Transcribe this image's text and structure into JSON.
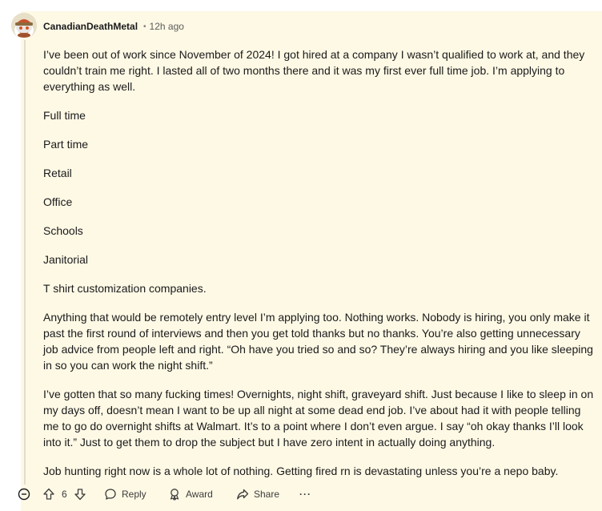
{
  "comment": {
    "username": "CanadianDeathMetal",
    "separator": "•",
    "timestamp": "12h ago",
    "paragraphs": [
      "I’ve been out of work since November of 2024! I got hired at a company I wasn’t qualified to work at, and they couldn’t train me right. I lasted all of two months there and it was my first ever full time job. I’m applying to everything as well.",
      "Full time",
      "Part time",
      "Retail",
      "Office",
      "Schools",
      "Janitorial",
      "T shirt customization companies.",
      "Anything that would be remotely entry level I’m applying too. Nothing works. Nobody is hiring, you only make it past the first round of interviews and then you get told thanks but no thanks. You’re also getting unnecessary job advice from people left and right. “Oh have you tried so and so? They’re always hiring and you like sleeping in so you can work the night shift.”",
      "I’ve gotten that so many fucking times! Overnights, night shift, graveyard shift. Just because I like to sleep in on my days off, doesn’t mean I want to be up all night at some dead end job. I’ve about had it with people telling me to go do overnight shifts at Walmart. It’s to a point where I don’t even argue. I say “oh okay thanks I’ll look into it.” Just to get them to drop the subject but I have zero intent in actually doing anything.",
      "Job hunting right now is a whole lot of nothing. Getting fired rn is devastating unless you’re a nepo baby."
    ]
  },
  "actions": {
    "vote_count": "6",
    "reply_label": "Reply",
    "award_label": "Award",
    "share_label": "Share",
    "more_label": "···"
  },
  "icons": {
    "collapse": "collapse-thread-icon",
    "upvote": "upvote-arrow-icon",
    "downvote": "downvote-arrow-icon",
    "reply": "speech-bubble-icon",
    "award": "award-ribbon-icon",
    "share": "share-arrow-icon",
    "more": "more-options-icon"
  },
  "colors": {
    "highlight_background": "#fef9e5",
    "text": "#1a1a1b",
    "meta": "#5c5c5c"
  }
}
